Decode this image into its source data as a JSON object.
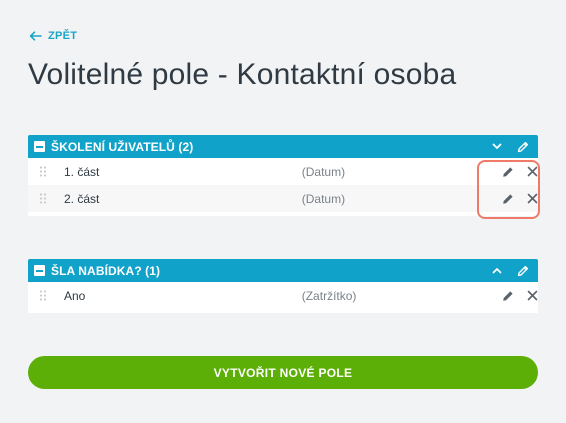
{
  "back": {
    "label": "ZPĚT"
  },
  "page": {
    "title": "Volitelné pole - Kontaktní osoba"
  },
  "groups": [
    {
      "title": "ŠKOLENÍ UŽIVATELŮ (2)",
      "expanded_icon": "chevron-down-icon",
      "rows": [
        {
          "name": "1. část",
          "type": "(Datum)"
        },
        {
          "name": "2. část",
          "type": "(Datum)"
        }
      ]
    },
    {
      "title": "ŠLA NABÍDKA? (1)",
      "expanded_icon": "chevron-up-icon",
      "rows": [
        {
          "name": "Ano",
          "type": "(Zatržítko)"
        }
      ]
    }
  ],
  "create_button": {
    "label": "VYTVOŘIT NOVÉ POLE"
  },
  "colors": {
    "accent": "#10a2c8",
    "link": "#1aa6c5",
    "primary_button": "#5caf06",
    "highlight": "#ef7a6a",
    "background": "#f2f3f5"
  }
}
